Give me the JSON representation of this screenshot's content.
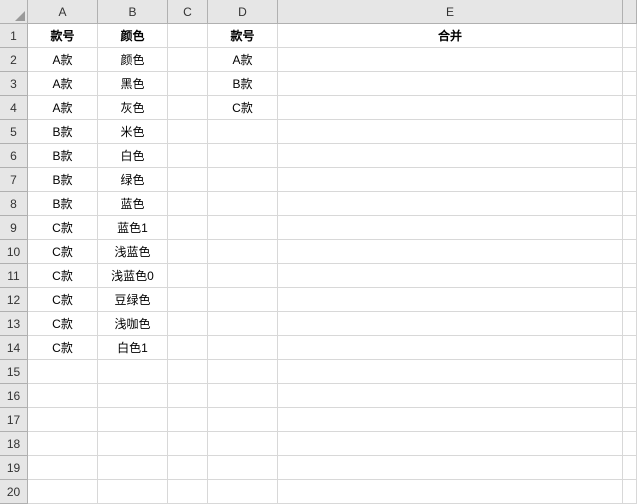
{
  "columns": [
    "A",
    "B",
    "C",
    "D",
    "E",
    ""
  ],
  "row_count": 20,
  "chart_data": {
    "type": "table",
    "headers_row1": {
      "A": "款号",
      "B": "颜色",
      "C": "",
      "D": "款号",
      "E": "合并"
    },
    "rows": [
      {
        "A": "A款",
        "B": "颜色",
        "C": "",
        "D": "A款",
        "E": ""
      },
      {
        "A": "A款",
        "B": "黑色",
        "C": "",
        "D": "B款",
        "E": ""
      },
      {
        "A": "A款",
        "B": "灰色",
        "C": "",
        "D": "C款",
        "E": ""
      },
      {
        "A": "B款",
        "B": "米色",
        "C": "",
        "D": "",
        "E": ""
      },
      {
        "A": "B款",
        "B": "白色",
        "C": "",
        "D": "",
        "E": ""
      },
      {
        "A": "B款",
        "B": "绿色",
        "C": "",
        "D": "",
        "E": ""
      },
      {
        "A": "B款",
        "B": "蓝色",
        "C": "",
        "D": "",
        "E": ""
      },
      {
        "A": "C款",
        "B": "蓝色1",
        "C": "",
        "D": "",
        "E": ""
      },
      {
        "A": "C款",
        "B": "浅蓝色",
        "C": "",
        "D": "",
        "E": ""
      },
      {
        "A": "C款",
        "B": "浅蓝色0",
        "C": "",
        "D": "",
        "E": ""
      },
      {
        "A": "C款",
        "B": "豆绿色",
        "C": "",
        "D": "",
        "E": ""
      },
      {
        "A": "C款",
        "B": "浅咖色",
        "C": "",
        "D": "",
        "E": ""
      },
      {
        "A": "C款",
        "B": "白色1",
        "C": "",
        "D": "",
        "E": ""
      }
    ]
  }
}
